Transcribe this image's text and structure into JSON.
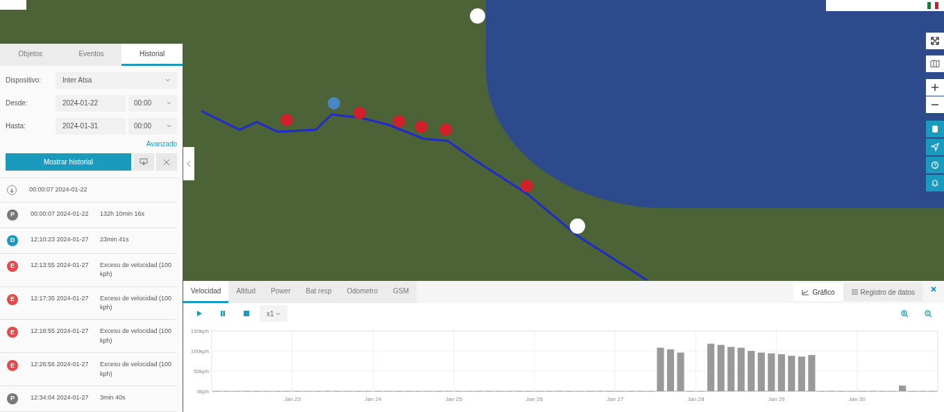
{
  "sidebar": {
    "tabs": [
      {
        "label": "Objetos",
        "selected": false
      },
      {
        "label": "Eventos",
        "selected": false
      },
      {
        "label": "Historial",
        "selected": true
      }
    ],
    "form": [
      {
        "label": "Dispositivo:",
        "value": "Inter Atsa"
      },
      {
        "label": "Desde:",
        "value": "2024-01-22",
        "time": "00:00"
      },
      {
        "label": "Hasta:",
        "value": "2024-01-31",
        "time": "00:00"
      }
    ],
    "advanced_link": "Avanzado",
    "show_button": "Mostrar historial",
    "items": [
      {
        "kind": "start",
        "time": "00:00:07 2024-01-22"
      },
      {
        "kind": "badge",
        "letter": "P",
        "color": "#777777",
        "time": "00:00:07 2024-01-22",
        "detail": "132h 10min 16s"
      },
      {
        "kind": "badge",
        "letter": "D",
        "color": "#1a9bbd",
        "time": "12:10:23 2024-01-27",
        "detail": "23min 41s"
      },
      {
        "kind": "badge",
        "letter": "E",
        "color": "#e04b4b",
        "time": "12:13:55 2024-01-27",
        "detail": "Exceso de velocidad (100 kph)"
      },
      {
        "kind": "badge",
        "letter": "E",
        "color": "#e04b4b",
        "time": "12:17:35 2024-01-27",
        "detail": "Exceso de velocidad (100 kph)"
      },
      {
        "kind": "badge",
        "letter": "E",
        "color": "#e04b4b",
        "time": "12:18:55 2024-01-27",
        "detail": "Exceso de velocidad (100 kph)"
      },
      {
        "kind": "badge",
        "letter": "E",
        "color": "#e04b4b",
        "time": "12:26:56 2024-01-27",
        "detail": "Exceso de velocidad (100 kph)"
      },
      {
        "kind": "badge",
        "letter": "P",
        "color": "#777777",
        "time": "12:34:04 2024-01-27",
        "detail": "3min 40s"
      }
    ]
  },
  "bottom_panel": {
    "tabs": [
      {
        "label": "Velocidad",
        "selected": true
      },
      {
        "label": "Altitud",
        "selected": false
      },
      {
        "label": "Power",
        "selected": false
      },
      {
        "label": "Bat resp",
        "selected": false
      },
      {
        "label": "Odometro",
        "selected": false
      },
      {
        "label": "GSM",
        "selected": false
      }
    ],
    "views": [
      {
        "kind": "chart",
        "label": "Gráfico",
        "selected": true
      },
      {
        "kind": "log",
        "label": "Registro de datos",
        "selected": false
      }
    ],
    "speed": "x1",
    "chart_data": {
      "type": "bar",
      "grid": true,
      "ylim": [
        0,
        150
      ],
      "categories": [
        null,
        null,
        null,
        null,
        null,
        null,
        null,
        null,
        "Jan 23",
        null,
        null,
        null,
        null,
        null,
        null,
        null,
        "Jan 24",
        null,
        null,
        null,
        null,
        null,
        null,
        null,
        "Jan 25",
        null,
        null,
        null,
        null,
        null,
        null,
        null,
        "Jan 26",
        null,
        null,
        null,
        null,
        null,
        null,
        null,
        "Jan 27",
        null,
        null,
        null,
        null,
        null,
        null,
        null,
        "Jan 28",
        null,
        null,
        null,
        null,
        null,
        null,
        null,
        "Jan 29",
        null,
        null,
        null,
        null,
        null,
        null,
        null,
        "Jan 30",
        null,
        null,
        null,
        null,
        null,
        null,
        null
      ],
      "yticks": [
        {
          "value": 0,
          "label": "0kph"
        },
        {
          "value": 50,
          "label": "50kph"
        },
        {
          "value": 100,
          "label": "100kph"
        },
        {
          "value": 150,
          "label": "150kph"
        }
      ],
      "series": [
        {
          "color": "#999999",
          "values": [
            0,
            0,
            0,
            0,
            0,
            0,
            0,
            0,
            0,
            0,
            0,
            0,
            0,
            0,
            0,
            0,
            0,
            0,
            0,
            0,
            0,
            0,
            0,
            0,
            0,
            0,
            0,
            0,
            0,
            0,
            0,
            0,
            0,
            0,
            0,
            0,
            0,
            0,
            0,
            0,
            0,
            0,
            0,
            0,
            108,
            104,
            96,
            0,
            0,
            118,
            115,
            110,
            108,
            100,
            96,
            94,
            92,
            88,
            86,
            90,
            0,
            0,
            0,
            0,
            0,
            0,
            0,
            0,
            14,
            0,
            0,
            0
          ]
        }
      ]
    }
  }
}
